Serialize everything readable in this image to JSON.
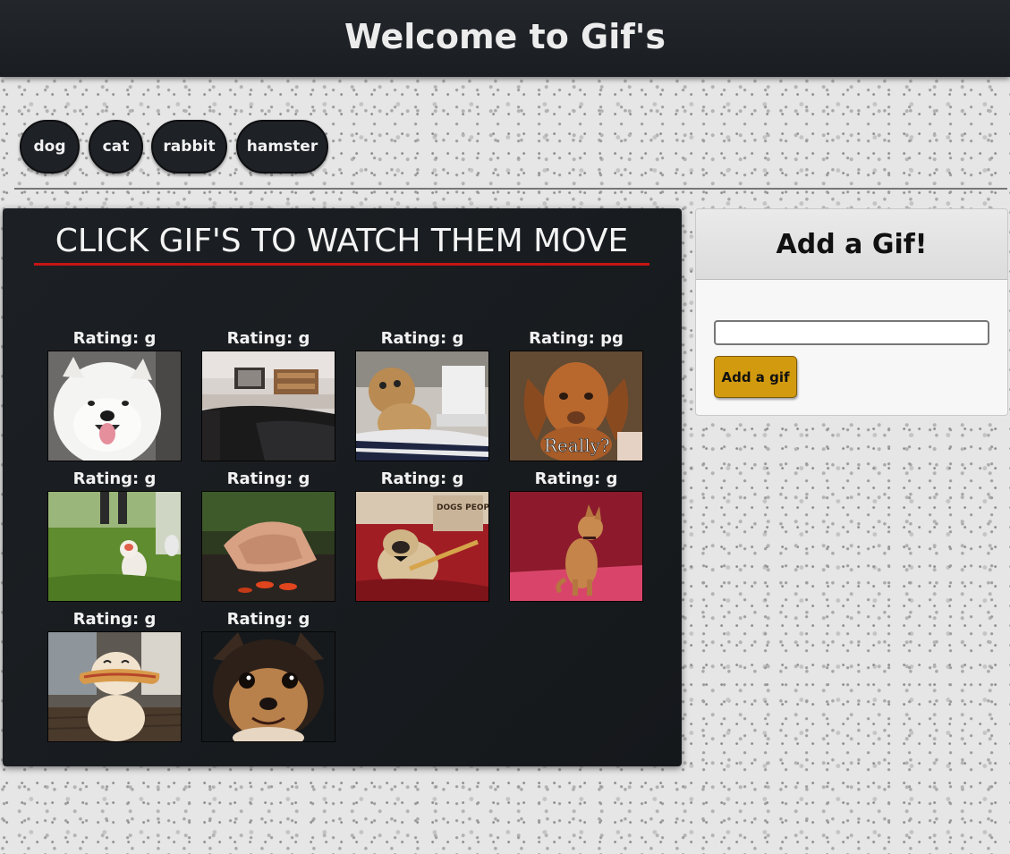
{
  "header": {
    "title": "Welcome to Gif's"
  },
  "topics": [
    {
      "label": "dog"
    },
    {
      "label": "cat"
    },
    {
      "label": "rabbit"
    },
    {
      "label": "hamster"
    }
  ],
  "gif_panel": {
    "title": "CLICK GIF'S TO WATCH THEM MOVE",
    "gifs": [
      {
        "rating": "Rating: g"
      },
      {
        "rating": "Rating: g"
      },
      {
        "rating": "Rating: g"
      },
      {
        "rating": "Rating: pg",
        "caption": "Really?"
      },
      {
        "rating": "Rating: g"
      },
      {
        "rating": "Rating: g"
      },
      {
        "rating": "Rating: g",
        "caption": "DOGS PEOPLE"
      },
      {
        "rating": "Rating: g"
      },
      {
        "rating": "Rating: g"
      },
      {
        "rating": "Rating: g"
      }
    ]
  },
  "add_panel": {
    "title": "Add a Gif!",
    "input_value": "",
    "button_label": "Add a gif"
  },
  "colors": {
    "header_bg": "#1f2327",
    "panel_bg": "#1a1d21",
    "accent_underline": "#c81414",
    "add_button": "#d29a0e"
  }
}
